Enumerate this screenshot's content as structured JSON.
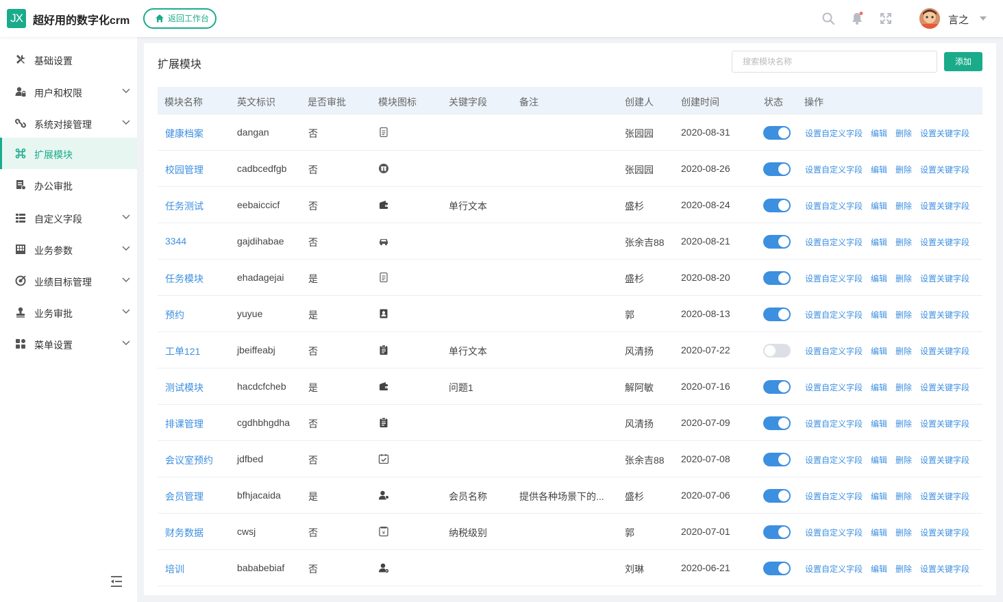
{
  "header": {
    "logo_text": "JX",
    "app_title": "超好用的数字化crm",
    "back_button": "返回工作台",
    "user_name": "言之",
    "icons": [
      "search-icon",
      "bell-icon",
      "fullscreen-icon",
      "chevron-down-icon"
    ],
    "notification_dot_color": "#f56c6c"
  },
  "sidebar": {
    "items": [
      {
        "label": "基础设置",
        "icon": "tools-icon",
        "has_children": false,
        "active": false
      },
      {
        "label": "用户和权限",
        "icon": "user-lock-icon",
        "has_children": true,
        "active": false
      },
      {
        "label": "系统对接管理",
        "icon": "link-icon",
        "has_children": true,
        "active": false
      },
      {
        "label": "扩展模块",
        "icon": "command-icon",
        "has_children": false,
        "active": true
      },
      {
        "label": "办公审批",
        "icon": "approval-doc-icon",
        "has_children": false,
        "active": false
      },
      {
        "label": "自定义字段",
        "icon": "list-icon",
        "has_children": true,
        "active": false
      },
      {
        "label": "业务参数",
        "icon": "grid-icon",
        "has_children": true,
        "active": false
      },
      {
        "label": "业绩目标管理",
        "icon": "target-icon",
        "has_children": true,
        "active": false
      },
      {
        "label": "业务审批",
        "icon": "stamp-icon",
        "has_children": true,
        "active": false
      },
      {
        "label": "菜单设置",
        "icon": "apps-icon",
        "has_children": true,
        "active": false
      }
    ]
  },
  "main": {
    "title": "扩展模块",
    "search_placeholder": "搜索模块名称",
    "add_button": "添加",
    "columns": [
      "模块名称",
      "英文标识",
      "是否审批",
      "模块图标",
      "关键字段",
      "备注",
      "创建人",
      "创建时间",
      "状态",
      "操作"
    ],
    "actions": [
      "设置自定义字段",
      "编辑",
      "删除",
      "设置关键字段"
    ],
    "rows": [
      {
        "name": "健康档案",
        "en": "dangan",
        "approval": "否",
        "icon": "document-icon",
        "key_field": "",
        "remark": "",
        "creator": "张园园",
        "created": "2020-08-31",
        "enabled": true
      },
      {
        "name": "校园管理",
        "en": "cadbcedfgb",
        "approval": "否",
        "icon": "gift-icon",
        "key_field": "",
        "remark": "",
        "creator": "张园园",
        "created": "2020-08-26",
        "enabled": true
      },
      {
        "name": "任务测试",
        "en": "eebaiccicf",
        "approval": "否",
        "icon": "wallet-icon",
        "key_field": "单行文本",
        "remark": "",
        "creator": "盛杉",
        "created": "2020-08-24",
        "enabled": true
      },
      {
        "name": "3344",
        "en": "gajdihabae",
        "approval": "否",
        "icon": "car-icon",
        "key_field": "",
        "remark": "",
        "creator": "张余吉88",
        "created": "2020-08-21",
        "enabled": true
      },
      {
        "name": "任务模块",
        "en": "ehadagejai",
        "approval": "是",
        "icon": "document-icon",
        "key_field": "",
        "remark": "",
        "creator": "盛杉",
        "created": "2020-08-20",
        "enabled": true
      },
      {
        "name": "预约",
        "en": "yuyue",
        "approval": "是",
        "icon": "contact-card-icon",
        "key_field": "",
        "remark": "",
        "creator": "郭",
        "created": "2020-08-13",
        "enabled": true
      },
      {
        "name": "工单121",
        "en": "jbeiffeabj",
        "approval": "否",
        "icon": "clipboard-icon",
        "key_field": "单行文本",
        "remark": "",
        "creator": "风清扬",
        "created": "2020-07-22",
        "enabled": false
      },
      {
        "name": "测试模块",
        "en": "hacdcfcheb",
        "approval": "是",
        "icon": "wallet-icon",
        "key_field": "问题1",
        "remark": "",
        "creator": "解阿敏",
        "created": "2020-07-16",
        "enabled": true
      },
      {
        "name": "排课管理",
        "en": "cgdhbhgdha",
        "approval": "否",
        "icon": "clipboard-icon",
        "key_field": "",
        "remark": "",
        "creator": "风清扬",
        "created": "2020-07-09",
        "enabled": true
      },
      {
        "name": "会议室预约",
        "en": "jdfbed",
        "approval": "否",
        "icon": "calendar-check-icon",
        "key_field": "",
        "remark": "",
        "creator": "张余吉88",
        "created": "2020-07-08",
        "enabled": true
      },
      {
        "name": "会员管理",
        "en": "bfhjacaida",
        "approval": "是",
        "icon": "user-badge-icon",
        "key_field": "会员名称",
        "remark": "提供各种场景下的...",
        "creator": "盛杉",
        "created": "2020-07-06",
        "enabled": true
      },
      {
        "name": "财务数据",
        "en": "cwsj",
        "approval": "否",
        "icon": "finance-icon",
        "key_field": "纳税级别",
        "remark": "",
        "creator": "郭",
        "created": "2020-07-01",
        "enabled": true
      },
      {
        "name": "培训",
        "en": "bababebiaf",
        "approval": "否",
        "icon": "user-gear-icon",
        "key_field": "",
        "remark": "",
        "creator": "刘琳",
        "created": "2020-06-21",
        "enabled": true
      }
    ]
  },
  "colors": {
    "brand": "#1aab8a",
    "link": "#3d8fe0",
    "header_row_bg": "#ecf3fa",
    "sidebar_active_bg": "#e8f6f2"
  }
}
